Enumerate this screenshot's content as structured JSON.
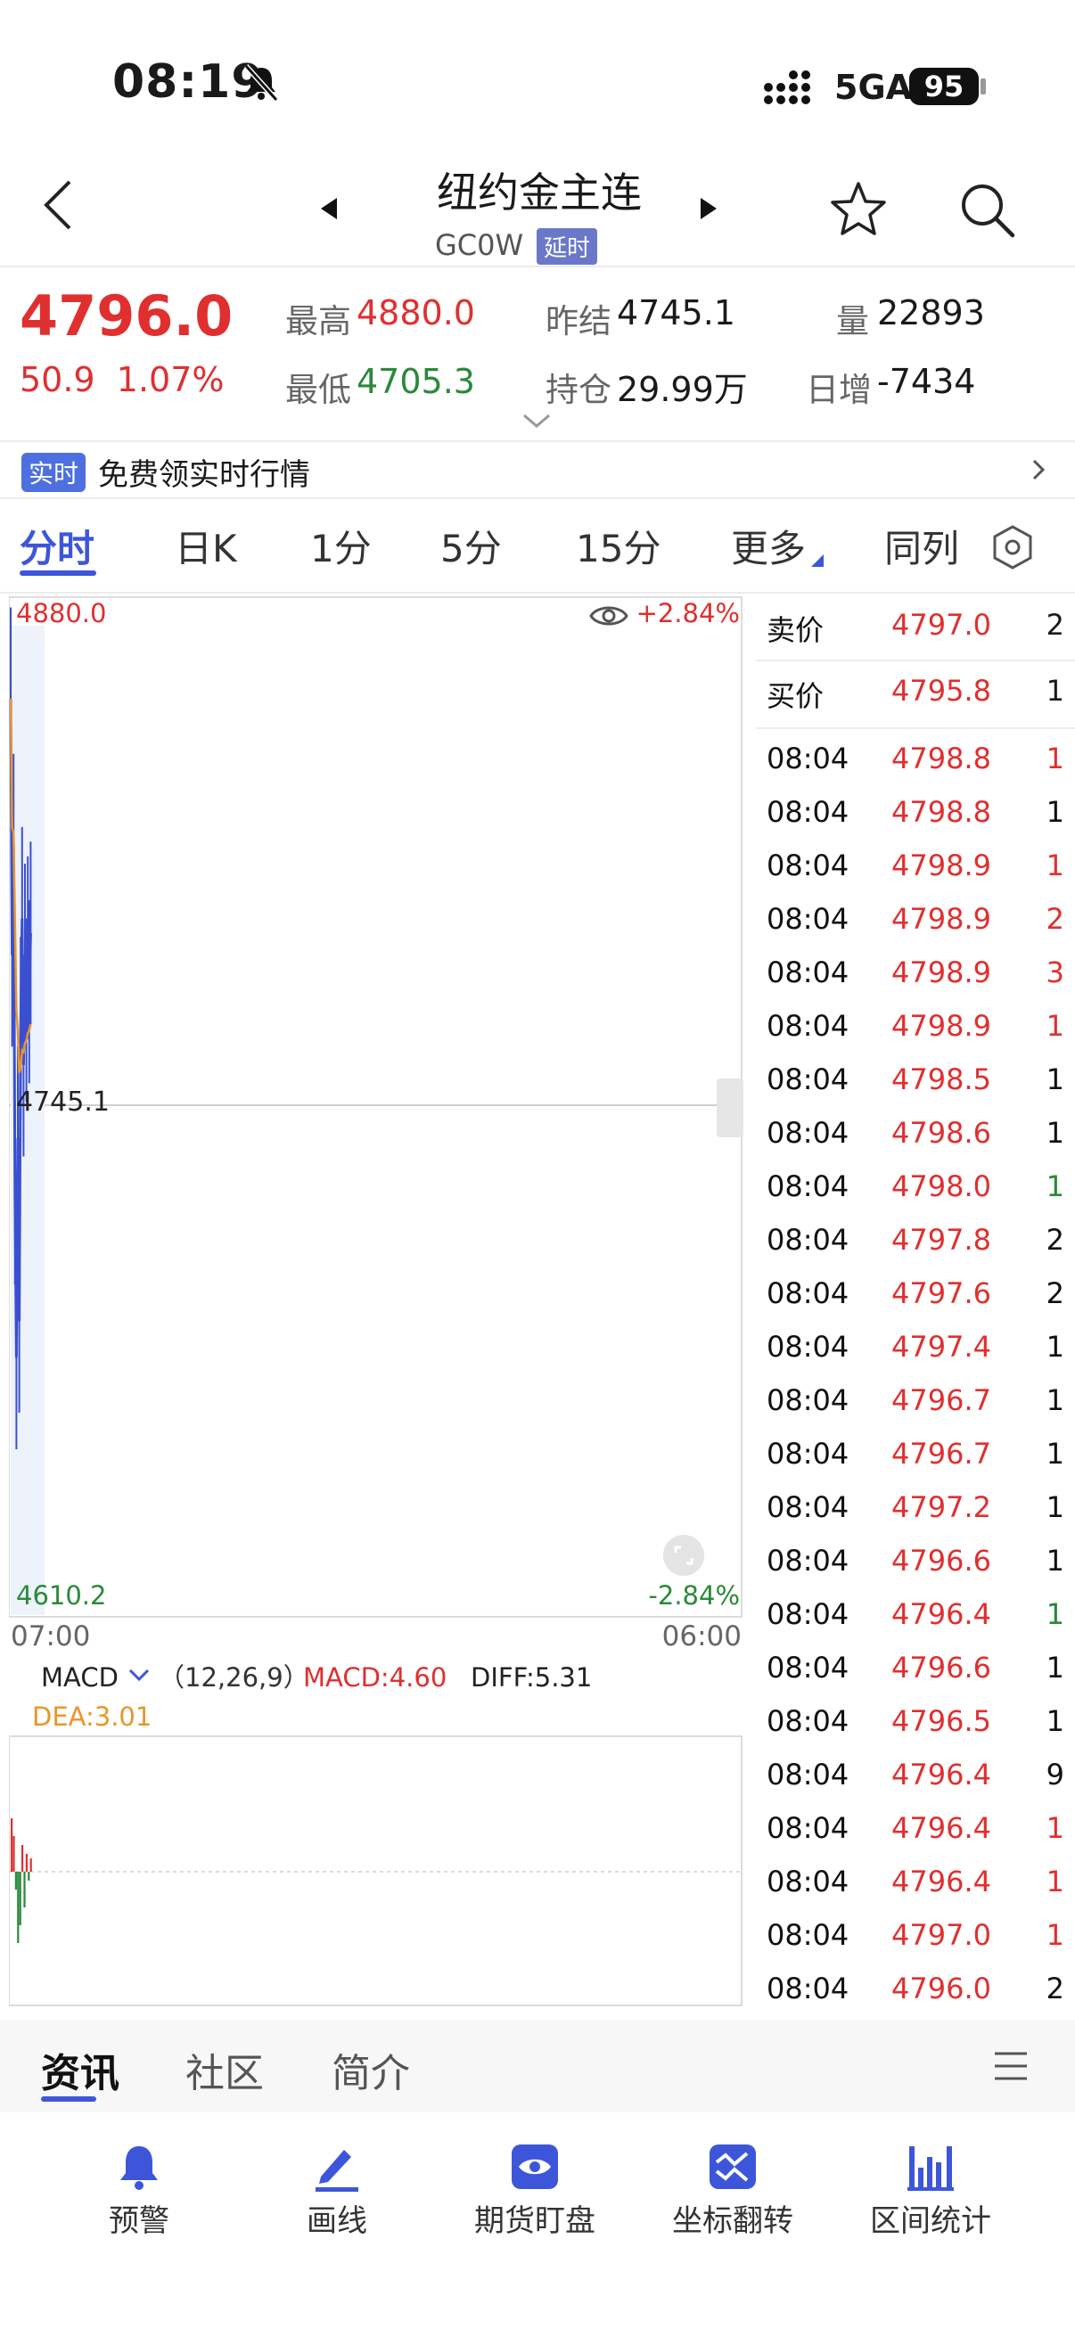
{
  "status_bar": {
    "time": "08:19",
    "network": "5GA",
    "battery": "95"
  },
  "header": {
    "title": "纽约金主连",
    "code": "GC0W",
    "delay_badge": "延时"
  },
  "quote": {
    "price": "4796.0",
    "change": "50.9",
    "change_pct": "1.07%",
    "high_label": "最高",
    "high": "4880.0",
    "low_label": "最低",
    "low": "4705.3",
    "prev_settle_label": "昨结",
    "prev_settle": "4745.1",
    "open_interest_label": "持仓",
    "open_interest": "29.99万",
    "volume_label": "量",
    "volume": "22893",
    "daily_inc_label": "日增",
    "daily_inc": "-7434"
  },
  "banner": {
    "badge": "实时",
    "text": "免费领实时行情"
  },
  "tabs": [
    {
      "label": "分时"
    },
    {
      "label": "日K"
    },
    {
      "label": "1分"
    },
    {
      "label": "5分"
    },
    {
      "label": "15分"
    },
    {
      "label": "更多"
    },
    {
      "label": "同列"
    }
  ],
  "chart": {
    "max_label": "4880.0",
    "mid_label": "4745.1",
    "min_label": "4610.2",
    "up_pct": "+2.84%",
    "down_pct": "-2.84%",
    "time_start": "07:00",
    "time_end": "06:00",
    "macd_name": "MACD",
    "macd_params": "（12,26,9）",
    "macd_value": "MACD:4.60",
    "diff_value": "DIFF:5.31",
    "dea_value": "DEA:3.01"
  },
  "chart_data": {
    "type": "line",
    "title": "",
    "ylim": [
      4610.2,
      4880.0
    ],
    "reference": 4745.1,
    "series": [
      {
        "name": "",
        "values": [
          4860,
          4790,
          4820,
          4725,
          4680,
          4740,
          4690,
          4770,
          4800,
          4760,
          4790,
          4775,
          4792,
          4780,
          4796
        ]
      }
    ]
  },
  "orderbook": {
    "ask_label": "卖价",
    "ask_price": "4797.0",
    "ask_vol": "2",
    "bid_label": "买价",
    "bid_price": "4795.8",
    "bid_vol": "1"
  },
  "trades": [
    {
      "time": "08:04",
      "price": "4798.8",
      "vol": "1",
      "dir": "red"
    },
    {
      "time": "08:04",
      "price": "4798.8",
      "vol": "1",
      "dir": "black"
    },
    {
      "time": "08:04",
      "price": "4798.9",
      "vol": "1",
      "dir": "red"
    },
    {
      "time": "08:04",
      "price": "4798.9",
      "vol": "2",
      "dir": "red"
    },
    {
      "time": "08:04",
      "price": "4798.9",
      "vol": "3",
      "dir": "red"
    },
    {
      "time": "08:04",
      "price": "4798.9",
      "vol": "1",
      "dir": "red"
    },
    {
      "time": "08:04",
      "price": "4798.5",
      "vol": "1",
      "dir": "black"
    },
    {
      "time": "08:04",
      "price": "4798.6",
      "vol": "1",
      "dir": "black"
    },
    {
      "time": "08:04",
      "price": "4798.0",
      "vol": "1",
      "dir": "green"
    },
    {
      "time": "08:04",
      "price": "4797.8",
      "vol": "2",
      "dir": "black"
    },
    {
      "time": "08:04",
      "price": "4797.6",
      "vol": "2",
      "dir": "black"
    },
    {
      "time": "08:04",
      "price": "4797.4",
      "vol": "1",
      "dir": "black"
    },
    {
      "time": "08:04",
      "price": "4796.7",
      "vol": "1",
      "dir": "black"
    },
    {
      "time": "08:04",
      "price": "4796.7",
      "vol": "1",
      "dir": "black"
    },
    {
      "time": "08:04",
      "price": "4797.2",
      "vol": "1",
      "dir": "black"
    },
    {
      "time": "08:04",
      "price": "4796.6",
      "vol": "1",
      "dir": "black"
    },
    {
      "time": "08:04",
      "price": "4796.4",
      "vol": "1",
      "dir": "green"
    },
    {
      "time": "08:04",
      "price": "4796.6",
      "vol": "1",
      "dir": "black"
    },
    {
      "time": "08:04",
      "price": "4796.5",
      "vol": "1",
      "dir": "black"
    },
    {
      "time": "08:04",
      "price": "4796.4",
      "vol": "9",
      "dir": "black"
    },
    {
      "time": "08:04",
      "price": "4796.4",
      "vol": "1",
      "dir": "red"
    },
    {
      "time": "08:04",
      "price": "4796.4",
      "vol": "1",
      "dir": "red"
    },
    {
      "time": "08:04",
      "price": "4797.0",
      "vol": "1",
      "dir": "red"
    },
    {
      "time": "08:04",
      "price": "4796.0",
      "vol": "2",
      "dir": "black"
    }
  ],
  "bottom_tabs": [
    {
      "label": "资讯"
    },
    {
      "label": "社区"
    },
    {
      "label": "简介"
    }
  ],
  "toolbar": [
    {
      "label": "预警",
      "icon": "bell-icon"
    },
    {
      "label": "画线",
      "icon": "draw-line-icon"
    },
    {
      "label": "期货盯盘",
      "icon": "eye-icon"
    },
    {
      "label": "坐标翻转",
      "icon": "flip-icon"
    },
    {
      "label": "区间统计",
      "icon": "range-stats-icon"
    }
  ],
  "colors": {
    "up": "#e02f2f",
    "down": "#2a8a3a",
    "accent": "#3d56d9",
    "line": "#3b4fd0",
    "avg": "#e8962a"
  }
}
